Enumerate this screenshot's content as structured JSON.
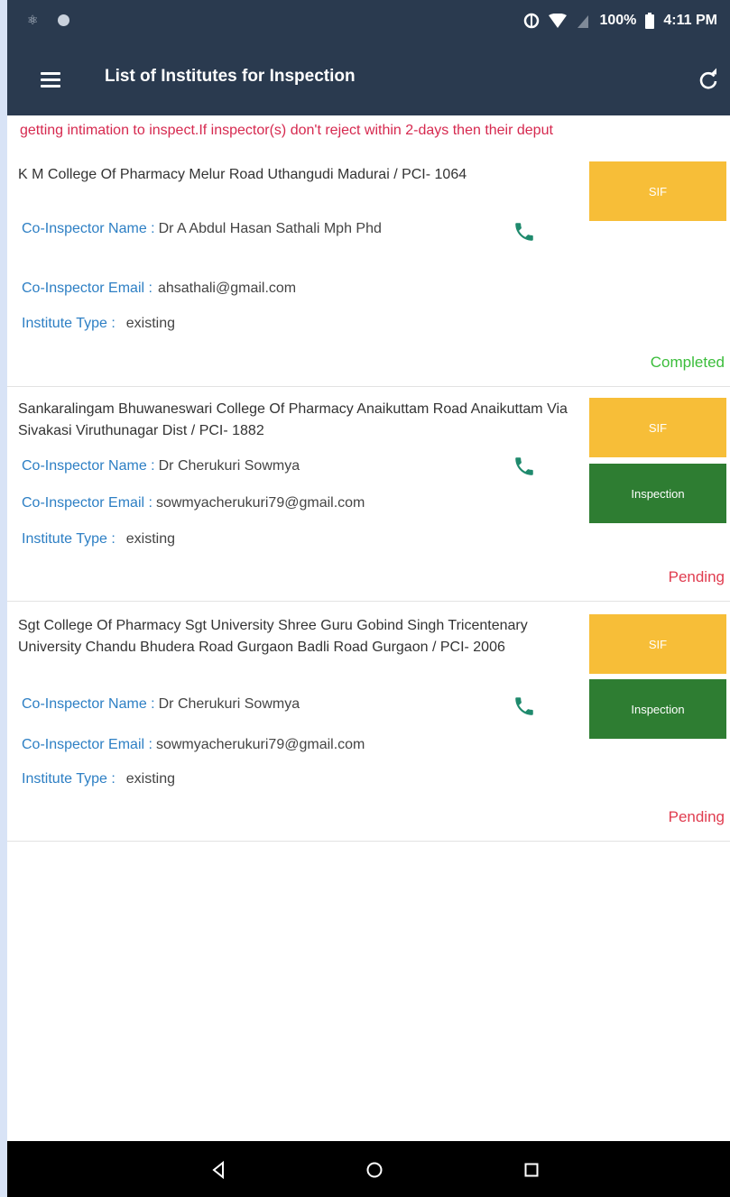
{
  "status_bar": {
    "battery": "100%",
    "time": "4:11 PM"
  },
  "app_bar": {
    "title": "List of Institutes for Inspection",
    "menu_icon": "hamburger-menu-icon",
    "refresh_icon": "refresh-icon"
  },
  "marquee": {
    "text": "getting intimation to inspect.If inspector(s) don't reject within 2-days then their deput"
  },
  "labels": {
    "co_inspector_name": "Co-Inspector Name :",
    "co_inspector_email": "Co-Inspector Email :",
    "institute_type": "Institute Type :"
  },
  "institutes": [
    {
      "title": "K M College Of Pharmacy Melur Road Uthangudi Madurai / PCI- 1064",
      "co_inspector_name": "Dr A Abdul Hasan Sathali Mph Phd",
      "co_inspector_email": "ahsathali@gmail.com",
      "institute_type": "existing",
      "sif_label": "SIF",
      "inspection_label": "",
      "status": "Completed"
    },
    {
      "title": "Sankaralingam Bhuwaneswari College Of Pharmacy Anaikuttam Road Anaikuttam Via Sivakasi Viruthunagar Dist / PCI- 1882",
      "co_inspector_name": "Dr Cherukuri Sowmya",
      "co_inspector_email": "sowmyacherukuri79@gmail.com",
      "institute_type": "existing",
      "sif_label": "SIF",
      "inspection_label": "Inspection",
      "status": "Pending"
    },
    {
      "title": "Sgt College Of Pharmacy Sgt University Shree Guru Gobind Singh Tricentenary University Chandu Bhudera Road Gurgaon Badli Road Gurgaon / PCI- 2006",
      "co_inspector_name": "Dr Cherukuri Sowmya",
      "co_inspector_email": "sowmyacherukuri79@gmail.com",
      "institute_type": "existing",
      "sif_label": "SIF",
      "inspection_label": "Inspection",
      "status": "Pending"
    }
  ],
  "colors": {
    "app_bar": "#2a3a4f",
    "marquee_text": "#d6294f",
    "label_blue": "#2d7fc4",
    "sif_button": "#f7be38",
    "inspection_button": "#2e7d32",
    "completed": "#3bbd3b",
    "pending": "#e03c4f",
    "phone_icon": "#1f8a6d"
  },
  "nav_bar": {
    "back_icon": "back-triangle-icon",
    "home_icon": "home-circle-icon",
    "recents_icon": "recents-square-icon"
  }
}
